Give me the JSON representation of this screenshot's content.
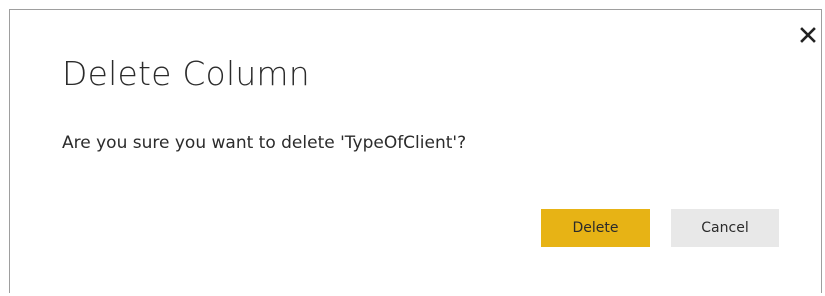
{
  "dialog": {
    "title": "Delete Column",
    "message": "Are you sure you want to delete 'TypeOfClient'?",
    "close_icon": "close-icon",
    "buttons": {
      "delete_label": "Delete",
      "cancel_label": "Cancel"
    },
    "colors": {
      "primary_button": "#e7b315",
      "secondary_button": "#e8e8e8",
      "text": "#2b2b2b"
    }
  }
}
